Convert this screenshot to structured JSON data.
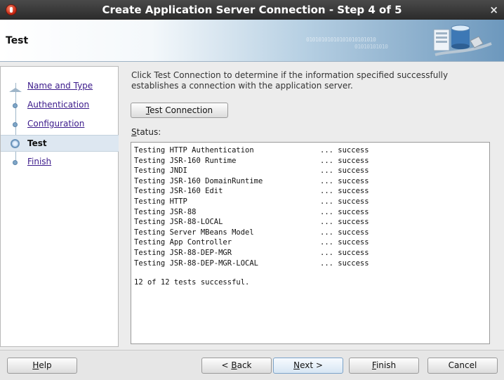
{
  "window": {
    "title": "Create Application Server Connection - Step 4 of 5",
    "close_glyph": "×"
  },
  "header": {
    "page_title": "Test",
    "binary_text_1": "01010101010101010101010",
    "binary_text_2": "01010101010"
  },
  "nav": {
    "items": [
      {
        "label": "Name and Type",
        "state": "visited"
      },
      {
        "label": "Authentication",
        "state": "visited"
      },
      {
        "label": "Configuration",
        "state": "visited"
      },
      {
        "label": "Test",
        "state": "current"
      },
      {
        "label": "Finish",
        "state": "pending"
      }
    ]
  },
  "main": {
    "intro": "Click Test Connection to determine if the information specified successfully establishes a connection with the application server.",
    "test_button": {
      "mnemonic": "T",
      "rest": "est Connection"
    },
    "status_label": {
      "mnemonic": "S",
      "rest": "tatus:"
    },
    "status_rows": [
      {
        "name": "Testing HTTP Authentication",
        "result": "... success"
      },
      {
        "name": "Testing JSR-160 Runtime",
        "result": "... success"
      },
      {
        "name": "Testing JNDI",
        "result": "... success"
      },
      {
        "name": "Testing JSR-160 DomainRuntime",
        "result": "... success"
      },
      {
        "name": "Testing JSR-160 Edit",
        "result": "... success"
      },
      {
        "name": "Testing HTTP",
        "result": "... success"
      },
      {
        "name": "Testing JSR-88",
        "result": "... success"
      },
      {
        "name": "Testing JSR-88-LOCAL",
        "result": "... success"
      },
      {
        "name": "Testing Server MBeans Model",
        "result": "... success"
      },
      {
        "name": "Testing App Controller",
        "result": "... success"
      },
      {
        "name": "Testing JSR-88-DEP-MGR",
        "result": "... success"
      },
      {
        "name": "Testing JSR-88-DEP-MGR-LOCAL",
        "result": "... success"
      }
    ],
    "summary": "12 of 12 tests successful."
  },
  "footer": {
    "help": {
      "mnemonic": "H",
      "rest": "elp"
    },
    "back": {
      "prefix": "< ",
      "mnemonic": "B",
      "rest": "ack"
    },
    "next": {
      "mnemonic": "N",
      "rest": "ext >"
    },
    "finish": {
      "mnemonic": "F",
      "rest": "inish"
    },
    "cancel": "Cancel"
  },
  "colors": {
    "title_bar": "#2b2b2b",
    "nav_link": "#3b1a8b",
    "current_step_bg": "#dde7f1",
    "header_accent": "#6d98bd"
  },
  "icons": {
    "app": "app-icon",
    "close": "close-icon",
    "server": "server-icon"
  }
}
